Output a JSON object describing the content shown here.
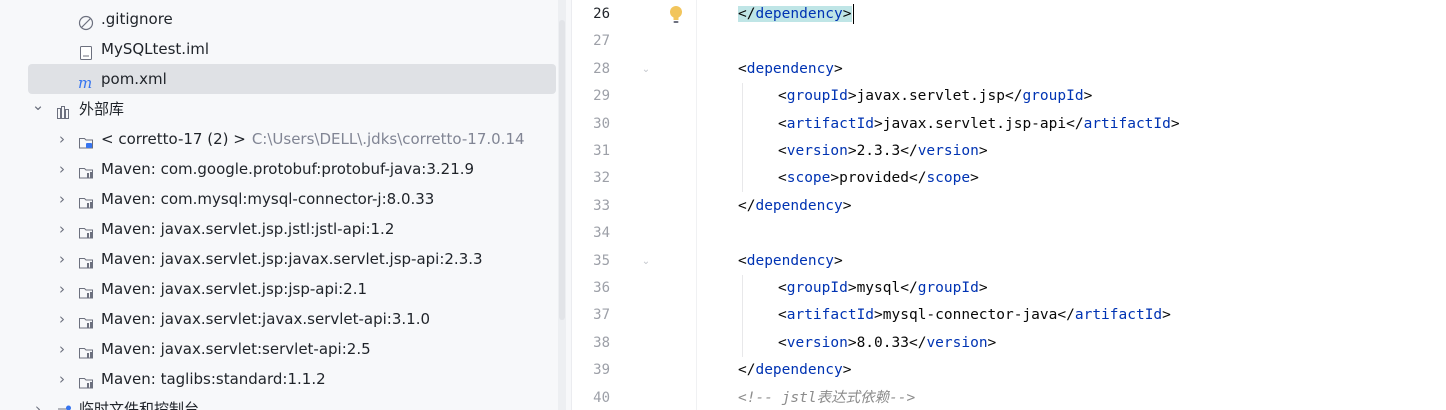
{
  "project_tree": {
    "rows": [
      {
        "label": ".gitignore",
        "icon": "ignore-file-icon"
      },
      {
        "label": "MySQLtest.iml",
        "icon": "iml-file-icon"
      },
      {
        "label": "pom.xml",
        "icon": "maven-m-icon"
      },
      {
        "label": "外部库",
        "icon": "library-icon"
      },
      {
        "label": "< corretto-17 (2) >",
        "path": "C:\\Users\\DELL\\.jdks\\corretto-17.0.14",
        "icon": "jdk-icon"
      },
      {
        "label": "Maven: com.google.protobuf:protobuf-java:3.21.9",
        "icon": "maven-library-icon"
      },
      {
        "label": "Maven: com.mysql:mysql-connector-j:8.0.33",
        "icon": "maven-library-icon"
      },
      {
        "label": "Maven: javax.servlet.jsp.jstl:jstl-api:1.2",
        "icon": "maven-library-icon"
      },
      {
        "label": "Maven: javax.servlet.jsp:javax.servlet.jsp-api:2.3.3",
        "icon": "maven-library-icon"
      },
      {
        "label": "Maven: javax.servlet.jsp:jsp-api:2.1",
        "icon": "maven-library-icon"
      },
      {
        "label": "Maven: javax.servlet:javax.servlet-api:3.1.0",
        "icon": "maven-library-icon"
      },
      {
        "label": "Maven: javax.servlet:servlet-api:2.5",
        "icon": "maven-library-icon"
      },
      {
        "label": "Maven: taglibs:standard:1.1.2",
        "icon": "maven-library-icon"
      },
      {
        "label": "临时文件和控制台",
        "icon": "scratches-icon"
      }
    ],
    "selected_index": 2
  },
  "editor": {
    "line_numbers": [
      "26",
      "27",
      "28",
      "29",
      "30",
      "31",
      "32",
      "33",
      "34",
      "35",
      "36",
      "37",
      "38",
      "39",
      "40"
    ],
    "current_line": "26",
    "lines": {
      "l26": {
        "tag": "dependency"
      },
      "l28": {
        "tag": "dependency"
      },
      "l29": {
        "tag": "groupId",
        "value": "javax.servlet.jsp"
      },
      "l30": {
        "tag": "artifactId",
        "value": "javax.servlet.jsp-api"
      },
      "l31": {
        "tag": "version",
        "value": "2.3.3"
      },
      "l32": {
        "tag": "scope",
        "value": "provided"
      },
      "l33": {
        "tag": "dependency"
      },
      "l35": {
        "tag": "dependency"
      },
      "l36": {
        "tag": "groupId",
        "value": "mysql"
      },
      "l37": {
        "tag": "artifactId",
        "value": "mysql-connector-java"
      },
      "l38": {
        "tag": "version",
        "value": "8.0.33"
      },
      "l39": {
        "tag": "dependency"
      },
      "l40": {
        "comment": "<!-- jstl表达式依赖-->"
      }
    },
    "colors": {
      "tag": "#0033b3",
      "comment": "#8c8c8c",
      "highlight": "#bfe5e6"
    },
    "gutter_icon": "lightbulb-icon"
  }
}
